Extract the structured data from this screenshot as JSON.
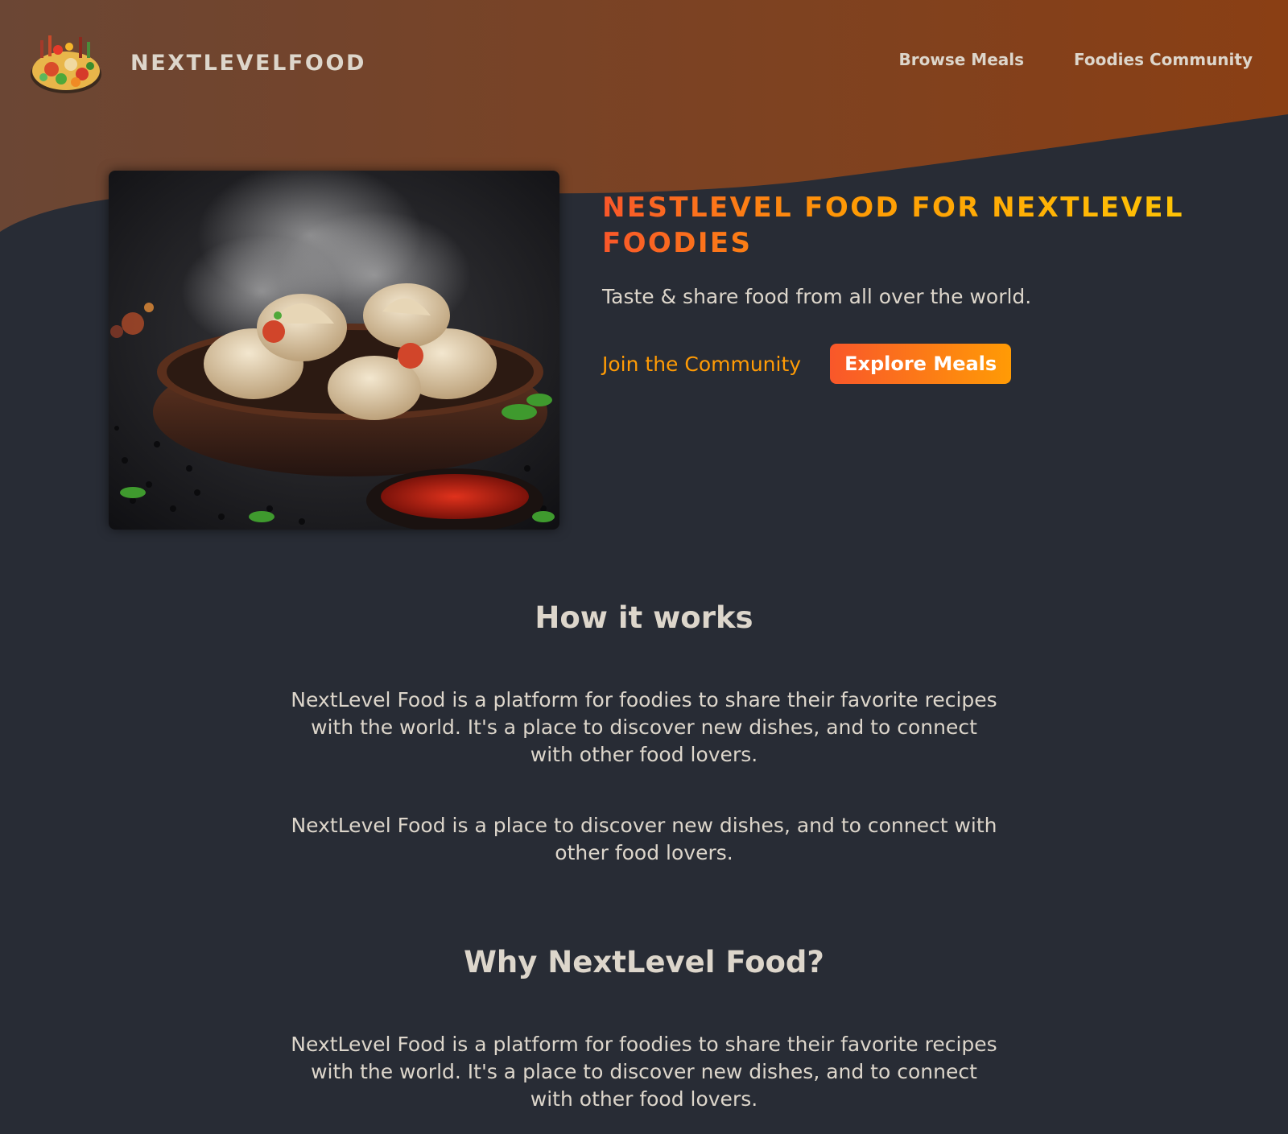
{
  "header": {
    "logo_text": "NEXTLEVELFOOD",
    "nav": [
      {
        "label": "Browse Meals"
      },
      {
        "label": "Foodies Community"
      }
    ]
  },
  "hero": {
    "title": "NESTLEVEL FOOD FOR NEXTLEVEL FOODIES",
    "subtitle": "Taste & share food from all over the world.",
    "cta_community": "Join the Community",
    "cta_explore": "Explore Meals"
  },
  "sections": {
    "how": {
      "heading": "How it works",
      "paragraphs": [
        "NextLevel Food is a platform for foodies to share their favorite recipes with the world. It's a place to discover new dishes, and to connect with other food lovers.",
        "NextLevel Food is a place to discover new dishes, and to connect with other food lovers."
      ]
    },
    "why": {
      "heading": "Why NextLevel Food?",
      "paragraphs": [
        "NextLevel Food is a platform for foodies to share their favorite recipes with the world. It's a place to discover new dishes, and to connect with other food lovers."
      ]
    }
  },
  "colors": {
    "background": "#282c35",
    "header_gradient_start": "#6b4634",
    "header_gradient_end": "#8a3f14",
    "text": "#ddd6cb",
    "accent_start": "#f9572a",
    "accent_end": "#ff9b05",
    "title_end": "#ffc905"
  }
}
